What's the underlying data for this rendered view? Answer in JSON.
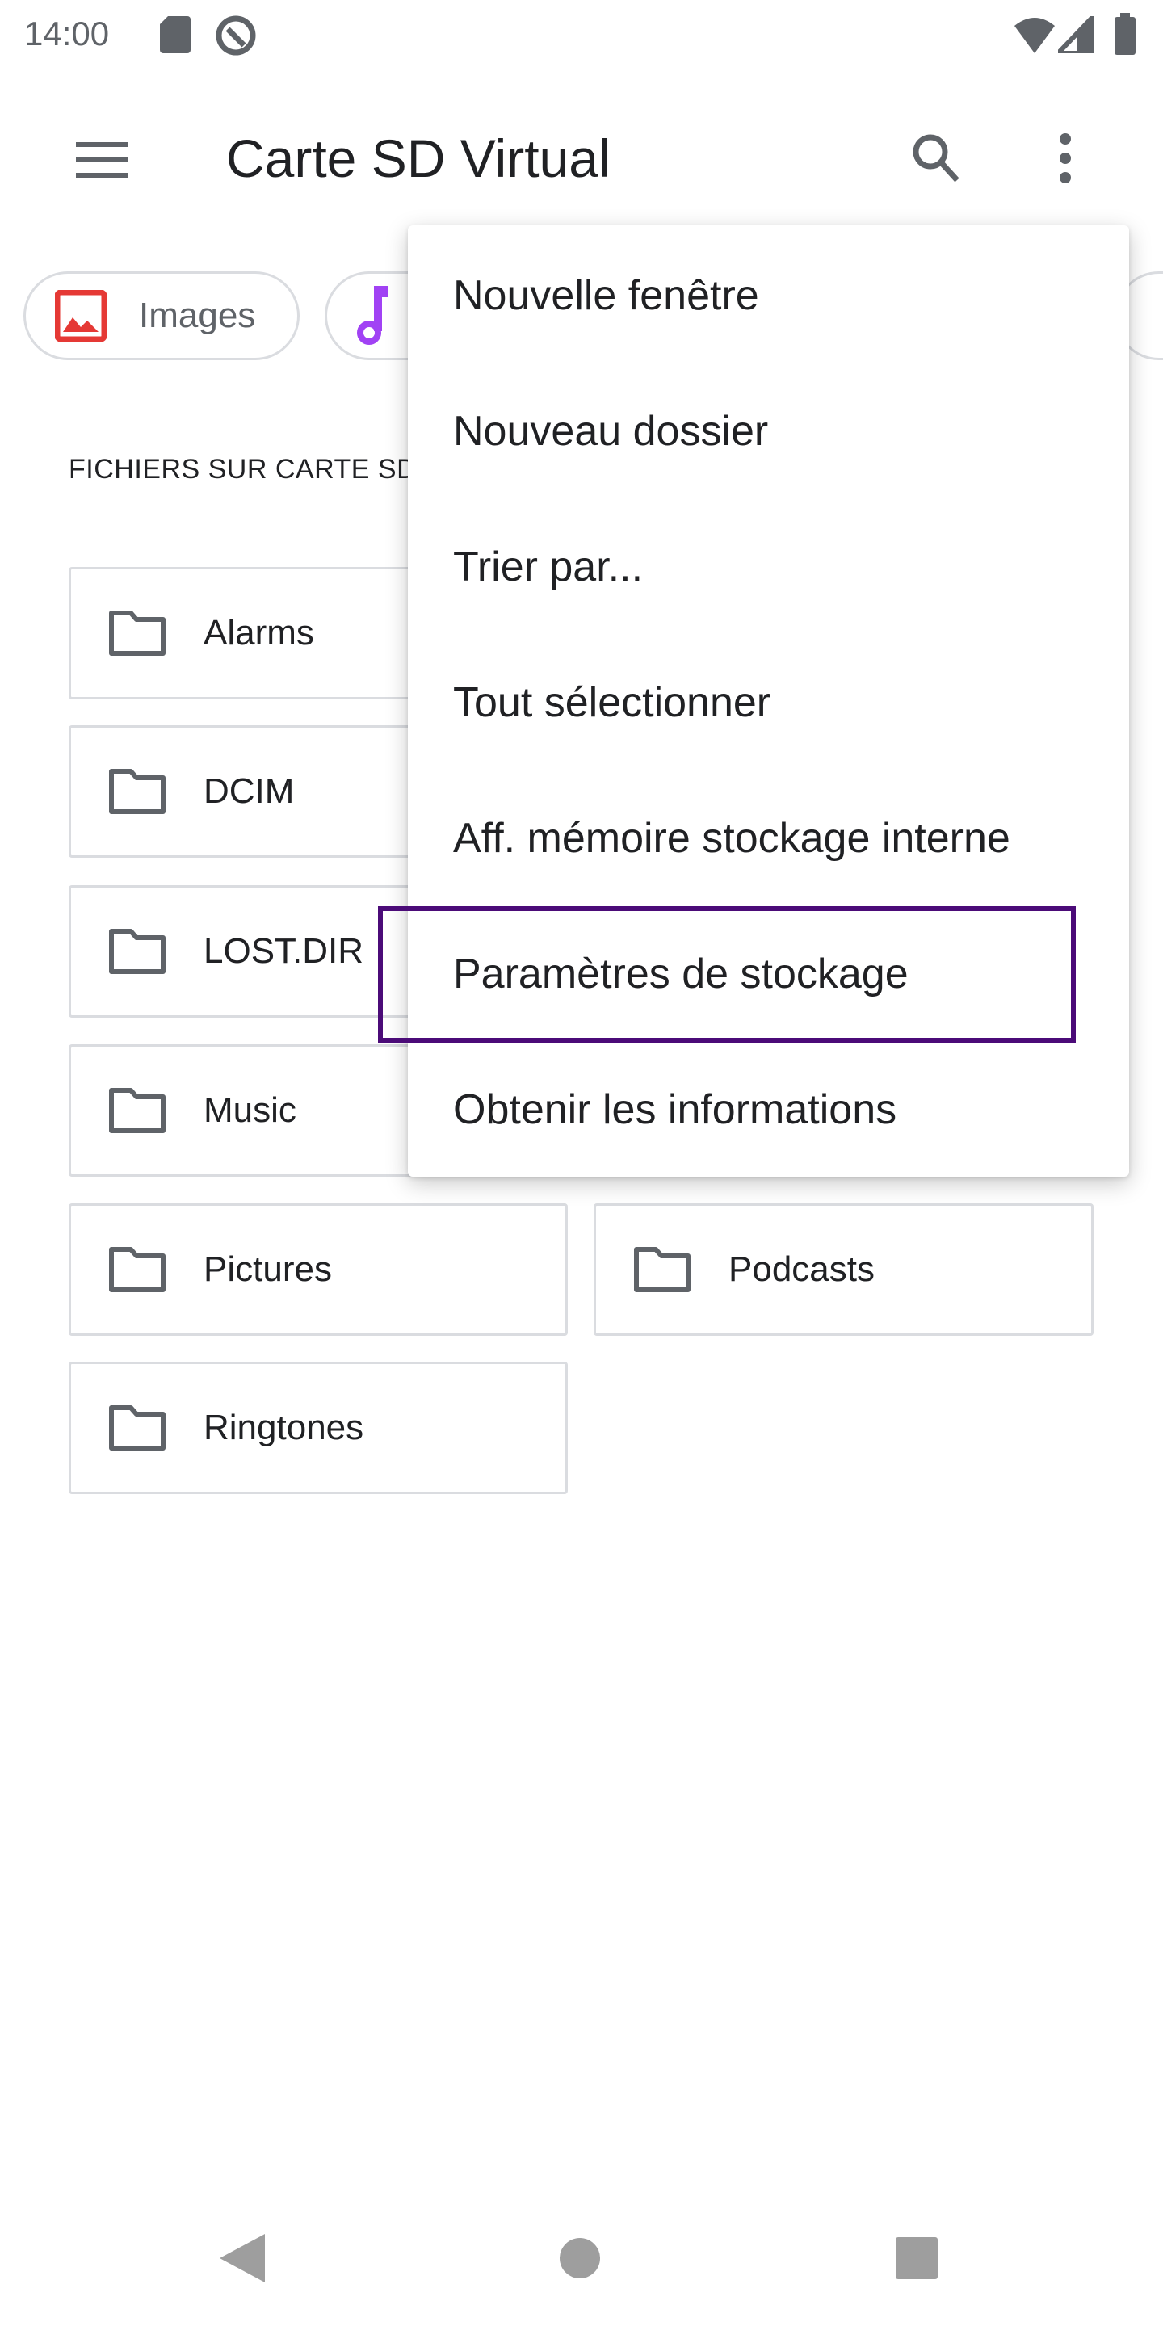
{
  "status_bar": {
    "time": "14:00",
    "icons": [
      "sd-card-icon",
      "data-saver-icon",
      "wifi-icon",
      "signal-icon",
      "battery-icon"
    ]
  },
  "app_bar": {
    "title": "Carte SD Virtual",
    "icons": [
      "menu-icon",
      "search-icon",
      "more-vert-icon"
    ]
  },
  "chips": [
    {
      "label": "Images",
      "icon": "image-icon",
      "color": "#e53935"
    },
    {
      "label": "",
      "icon": "music-note-icon",
      "color": "#a142f4"
    }
  ],
  "section_title": "FICHIERS SUR CARTE SD",
  "folders": [
    "Alarms",
    "DCIM",
    "LOST.DIR",
    "Music",
    "Pictures",
    "Podcasts",
    "Ringtones"
  ],
  "menu": {
    "items": [
      "Nouvelle fenêtre",
      "Nouveau dossier",
      "Trier par...",
      "Tout sélectionner",
      "Aff. mémoire stockage interne",
      "Paramètres de stockage",
      "Obtenir les informations"
    ],
    "highlighted": "Paramètres de stockage",
    "highlight_color": "#4b0b78"
  },
  "nav_bar": {
    "icons": [
      "back-icon",
      "home-icon",
      "recents-icon"
    ]
  }
}
